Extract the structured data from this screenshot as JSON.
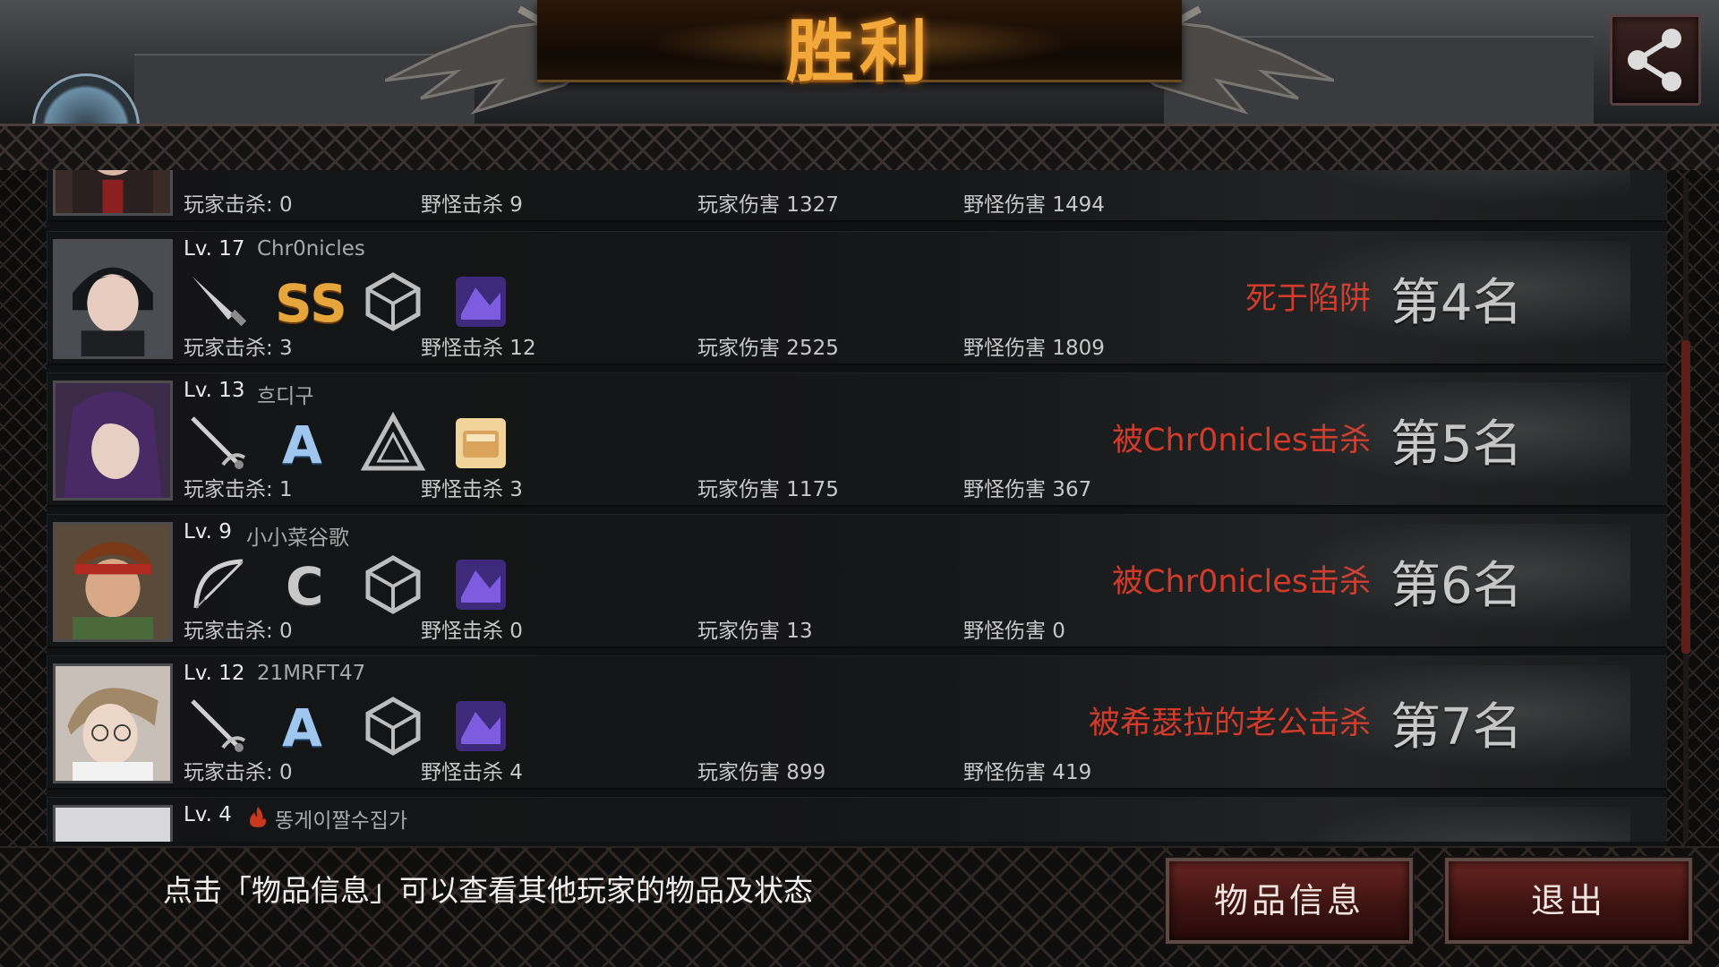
{
  "header": {
    "title": "胜利",
    "share_icon": "share-icon"
  },
  "players": [
    {
      "level": "",
      "name": "",
      "player_kills": "玩家击杀: 0",
      "monster_kills": "野怪击杀 9",
      "player_damage": "玩家伤害 1327",
      "monster_damage": "野怪伤害 1494",
      "death": "",
      "rank": ""
    },
    {
      "level": "Lv. 17",
      "name": "Chr0nicles",
      "grade": "SS",
      "player_kills": "玩家击杀: 3",
      "monster_kills": "野怪击杀 12",
      "player_damage": "玩家伤害 2525",
      "monster_damage": "野怪伤害 1809",
      "death": "死于陷阱",
      "rank": "第4名"
    },
    {
      "level": "Lv. 13",
      "name": "흐디구",
      "grade": "A",
      "player_kills": "玩家击杀: 1",
      "monster_kills": "野怪击杀 3",
      "player_damage": "玩家伤害 1175",
      "monster_damage": "野怪伤害 367",
      "death": "被Chr0nicles击杀",
      "rank": "第5名"
    },
    {
      "level": "Lv. 9",
      "name": "小小菜谷歌",
      "grade": "C",
      "player_kills": "玩家击杀: 0",
      "monster_kills": "野怪击杀 0",
      "player_damage": "玩家伤害 13",
      "monster_damage": "野怪伤害 0",
      "death": "被Chr0nicles击杀",
      "rank": "第6名"
    },
    {
      "level": "Lv. 12",
      "name": "21MRFT47",
      "grade": "A",
      "player_kills": "玩家击杀: 0",
      "monster_kills": "野怪击杀 4",
      "player_damage": "玩家伤害 899",
      "monster_damage": "野怪伤害 419",
      "death": "被希瑟拉的老公击杀",
      "rank": "第7名"
    },
    {
      "level": "Lv. 4",
      "name": "똥게이짤수집가"
    }
  ],
  "footer": {
    "hint": "点击「物品信息」可以查看其他玩家的物品及状态",
    "item_info_label": "物品信息",
    "exit_label": "退出"
  },
  "colors": {
    "title_gold": "#f3a93a",
    "death_red": "#d23a2a",
    "button_red": "#6a2622"
  }
}
